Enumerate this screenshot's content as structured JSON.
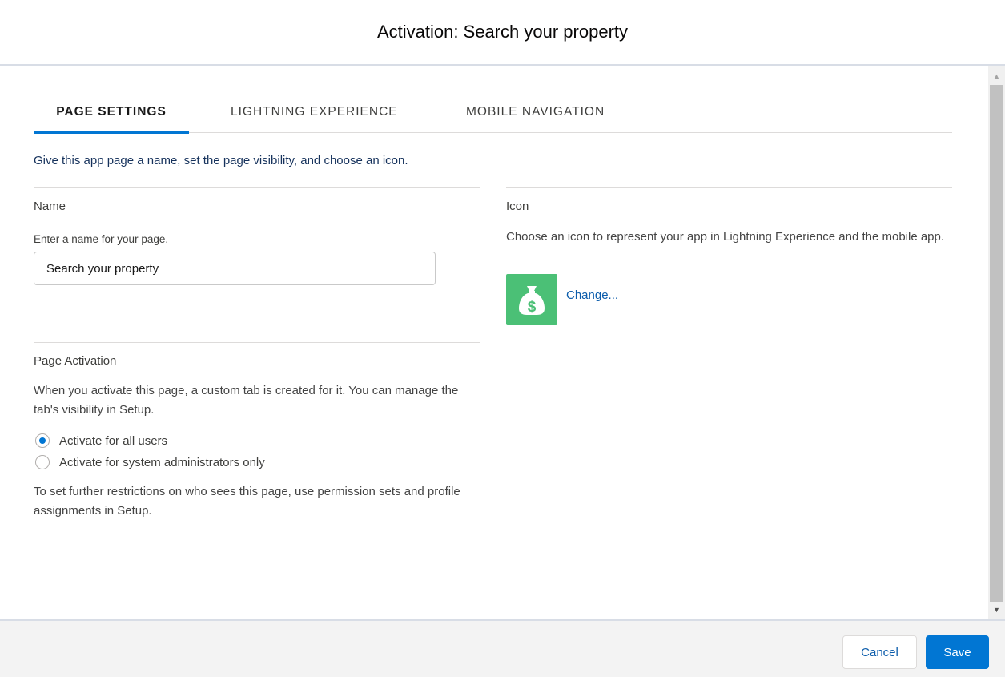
{
  "modal": {
    "title": "Activation: Search your property"
  },
  "tabs": [
    {
      "label": "PAGE SETTINGS",
      "active": true
    },
    {
      "label": "LIGHTNING EXPERIENCE",
      "active": false
    },
    {
      "label": "MOBILE NAVIGATION",
      "active": false
    }
  ],
  "intro": "Give this app page a name, set the page visibility, and choose an icon.",
  "name_section": {
    "heading": "Name",
    "field_label": "Enter a name for your page.",
    "value": "Search your property"
  },
  "icon_section": {
    "heading": "Icon",
    "description": "Choose an icon to represent your app in Lightning Experience and the mobile app.",
    "icon": "money-bag-icon",
    "icon_color": "#4bc076",
    "change_link": "Change..."
  },
  "activation_section": {
    "heading": "Page Activation",
    "description": "When you activate this page, a custom tab is created for it. You can manage the tab's visibility in Setup.",
    "options": [
      {
        "label": "Activate for all users",
        "selected": true
      },
      {
        "label": "Activate for system administrators only",
        "selected": false
      }
    ],
    "note": "To set further restrictions on who sees this page, use permission sets and profile assignments in Setup."
  },
  "footer": {
    "cancel_label": "Cancel",
    "save_label": "Save"
  },
  "colors": {
    "brand": "#0176d3",
    "link": "#0b5cab"
  }
}
